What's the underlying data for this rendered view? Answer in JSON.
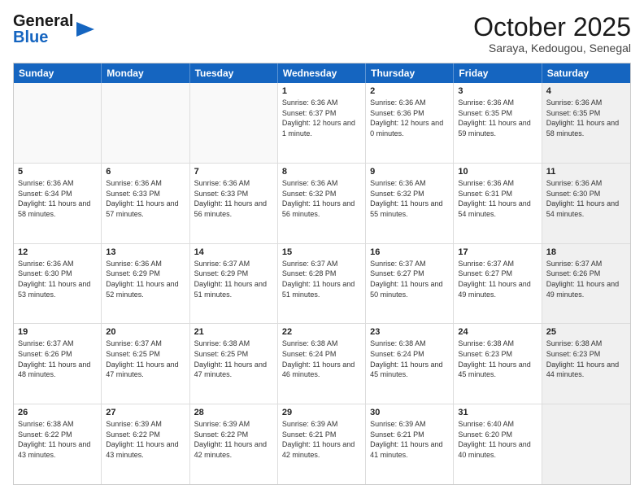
{
  "logo": {
    "line1": "General",
    "line2": "Blue",
    "icon": "▶"
  },
  "header": {
    "month": "October 2025",
    "location": "Saraya, Kedougou, Senegal"
  },
  "weekdays": [
    "Sunday",
    "Monday",
    "Tuesday",
    "Wednesday",
    "Thursday",
    "Friday",
    "Saturday"
  ],
  "rows": [
    [
      {
        "day": "",
        "sunrise": "",
        "sunset": "",
        "daylight": "",
        "shaded": false,
        "empty": true
      },
      {
        "day": "",
        "sunrise": "",
        "sunset": "",
        "daylight": "",
        "shaded": false,
        "empty": true
      },
      {
        "day": "",
        "sunrise": "",
        "sunset": "",
        "daylight": "",
        "shaded": false,
        "empty": true
      },
      {
        "day": "1",
        "sunrise": "Sunrise: 6:36 AM",
        "sunset": "Sunset: 6:37 PM",
        "daylight": "Daylight: 12 hours and 1 minute.",
        "shaded": false,
        "empty": false
      },
      {
        "day": "2",
        "sunrise": "Sunrise: 6:36 AM",
        "sunset": "Sunset: 6:36 PM",
        "daylight": "Daylight: 12 hours and 0 minutes.",
        "shaded": false,
        "empty": false
      },
      {
        "day": "3",
        "sunrise": "Sunrise: 6:36 AM",
        "sunset": "Sunset: 6:35 PM",
        "daylight": "Daylight: 11 hours and 59 minutes.",
        "shaded": false,
        "empty": false
      },
      {
        "day": "4",
        "sunrise": "Sunrise: 6:36 AM",
        "sunset": "Sunset: 6:35 PM",
        "daylight": "Daylight: 11 hours and 58 minutes.",
        "shaded": true,
        "empty": false
      }
    ],
    [
      {
        "day": "5",
        "sunrise": "Sunrise: 6:36 AM",
        "sunset": "Sunset: 6:34 PM",
        "daylight": "Daylight: 11 hours and 58 minutes.",
        "shaded": false,
        "empty": false
      },
      {
        "day": "6",
        "sunrise": "Sunrise: 6:36 AM",
        "sunset": "Sunset: 6:33 PM",
        "daylight": "Daylight: 11 hours and 57 minutes.",
        "shaded": false,
        "empty": false
      },
      {
        "day": "7",
        "sunrise": "Sunrise: 6:36 AM",
        "sunset": "Sunset: 6:33 PM",
        "daylight": "Daylight: 11 hours and 56 minutes.",
        "shaded": false,
        "empty": false
      },
      {
        "day": "8",
        "sunrise": "Sunrise: 6:36 AM",
        "sunset": "Sunset: 6:32 PM",
        "daylight": "Daylight: 11 hours and 56 minutes.",
        "shaded": false,
        "empty": false
      },
      {
        "day": "9",
        "sunrise": "Sunrise: 6:36 AM",
        "sunset": "Sunset: 6:32 PM",
        "daylight": "Daylight: 11 hours and 55 minutes.",
        "shaded": false,
        "empty": false
      },
      {
        "day": "10",
        "sunrise": "Sunrise: 6:36 AM",
        "sunset": "Sunset: 6:31 PM",
        "daylight": "Daylight: 11 hours and 54 minutes.",
        "shaded": false,
        "empty": false
      },
      {
        "day": "11",
        "sunrise": "Sunrise: 6:36 AM",
        "sunset": "Sunset: 6:30 PM",
        "daylight": "Daylight: 11 hours and 54 minutes.",
        "shaded": true,
        "empty": false
      }
    ],
    [
      {
        "day": "12",
        "sunrise": "Sunrise: 6:36 AM",
        "sunset": "Sunset: 6:30 PM",
        "daylight": "Daylight: 11 hours and 53 minutes.",
        "shaded": false,
        "empty": false
      },
      {
        "day": "13",
        "sunrise": "Sunrise: 6:36 AM",
        "sunset": "Sunset: 6:29 PM",
        "daylight": "Daylight: 11 hours and 52 minutes.",
        "shaded": false,
        "empty": false
      },
      {
        "day": "14",
        "sunrise": "Sunrise: 6:37 AM",
        "sunset": "Sunset: 6:29 PM",
        "daylight": "Daylight: 11 hours and 51 minutes.",
        "shaded": false,
        "empty": false
      },
      {
        "day": "15",
        "sunrise": "Sunrise: 6:37 AM",
        "sunset": "Sunset: 6:28 PM",
        "daylight": "Daylight: 11 hours and 51 minutes.",
        "shaded": false,
        "empty": false
      },
      {
        "day": "16",
        "sunrise": "Sunrise: 6:37 AM",
        "sunset": "Sunset: 6:27 PM",
        "daylight": "Daylight: 11 hours and 50 minutes.",
        "shaded": false,
        "empty": false
      },
      {
        "day": "17",
        "sunrise": "Sunrise: 6:37 AM",
        "sunset": "Sunset: 6:27 PM",
        "daylight": "Daylight: 11 hours and 49 minutes.",
        "shaded": false,
        "empty": false
      },
      {
        "day": "18",
        "sunrise": "Sunrise: 6:37 AM",
        "sunset": "Sunset: 6:26 PM",
        "daylight": "Daylight: 11 hours and 49 minutes.",
        "shaded": true,
        "empty": false
      }
    ],
    [
      {
        "day": "19",
        "sunrise": "Sunrise: 6:37 AM",
        "sunset": "Sunset: 6:26 PM",
        "daylight": "Daylight: 11 hours and 48 minutes.",
        "shaded": false,
        "empty": false
      },
      {
        "day": "20",
        "sunrise": "Sunrise: 6:37 AM",
        "sunset": "Sunset: 6:25 PM",
        "daylight": "Daylight: 11 hours and 47 minutes.",
        "shaded": false,
        "empty": false
      },
      {
        "day": "21",
        "sunrise": "Sunrise: 6:38 AM",
        "sunset": "Sunset: 6:25 PM",
        "daylight": "Daylight: 11 hours and 47 minutes.",
        "shaded": false,
        "empty": false
      },
      {
        "day": "22",
        "sunrise": "Sunrise: 6:38 AM",
        "sunset": "Sunset: 6:24 PM",
        "daylight": "Daylight: 11 hours and 46 minutes.",
        "shaded": false,
        "empty": false
      },
      {
        "day": "23",
        "sunrise": "Sunrise: 6:38 AM",
        "sunset": "Sunset: 6:24 PM",
        "daylight": "Daylight: 11 hours and 45 minutes.",
        "shaded": false,
        "empty": false
      },
      {
        "day": "24",
        "sunrise": "Sunrise: 6:38 AM",
        "sunset": "Sunset: 6:23 PM",
        "daylight": "Daylight: 11 hours and 45 minutes.",
        "shaded": false,
        "empty": false
      },
      {
        "day": "25",
        "sunrise": "Sunrise: 6:38 AM",
        "sunset": "Sunset: 6:23 PM",
        "daylight": "Daylight: 11 hours and 44 minutes.",
        "shaded": true,
        "empty": false
      }
    ],
    [
      {
        "day": "26",
        "sunrise": "Sunrise: 6:38 AM",
        "sunset": "Sunset: 6:22 PM",
        "daylight": "Daylight: 11 hours and 43 minutes.",
        "shaded": false,
        "empty": false
      },
      {
        "day": "27",
        "sunrise": "Sunrise: 6:39 AM",
        "sunset": "Sunset: 6:22 PM",
        "daylight": "Daylight: 11 hours and 43 minutes.",
        "shaded": false,
        "empty": false
      },
      {
        "day": "28",
        "sunrise": "Sunrise: 6:39 AM",
        "sunset": "Sunset: 6:22 PM",
        "daylight": "Daylight: 11 hours and 42 minutes.",
        "shaded": false,
        "empty": false
      },
      {
        "day": "29",
        "sunrise": "Sunrise: 6:39 AM",
        "sunset": "Sunset: 6:21 PM",
        "daylight": "Daylight: 11 hours and 42 minutes.",
        "shaded": false,
        "empty": false
      },
      {
        "day": "30",
        "sunrise": "Sunrise: 6:39 AM",
        "sunset": "Sunset: 6:21 PM",
        "daylight": "Daylight: 11 hours and 41 minutes.",
        "shaded": false,
        "empty": false
      },
      {
        "day": "31",
        "sunrise": "Sunrise: 6:40 AM",
        "sunset": "Sunset: 6:20 PM",
        "daylight": "Daylight: 11 hours and 40 minutes.",
        "shaded": false,
        "empty": false
      },
      {
        "day": "",
        "sunrise": "",
        "sunset": "",
        "daylight": "",
        "shaded": true,
        "empty": true
      }
    ]
  ]
}
